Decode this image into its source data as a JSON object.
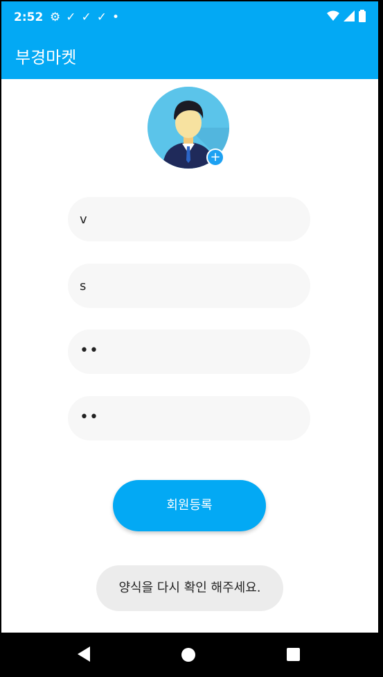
{
  "status": {
    "time": "2:52"
  },
  "app": {
    "title": "부경마켓"
  },
  "form": {
    "field1_value": "v",
    "field2_value": "s",
    "field3_value": "••",
    "field4_value": "••",
    "submit_label": "회원등록"
  },
  "toast": {
    "message": "양식을 다시 확인 해주세요."
  },
  "colors": {
    "primary": "#03a9f4",
    "field_bg": "#f7f7f7",
    "toast_bg": "#ececec"
  }
}
